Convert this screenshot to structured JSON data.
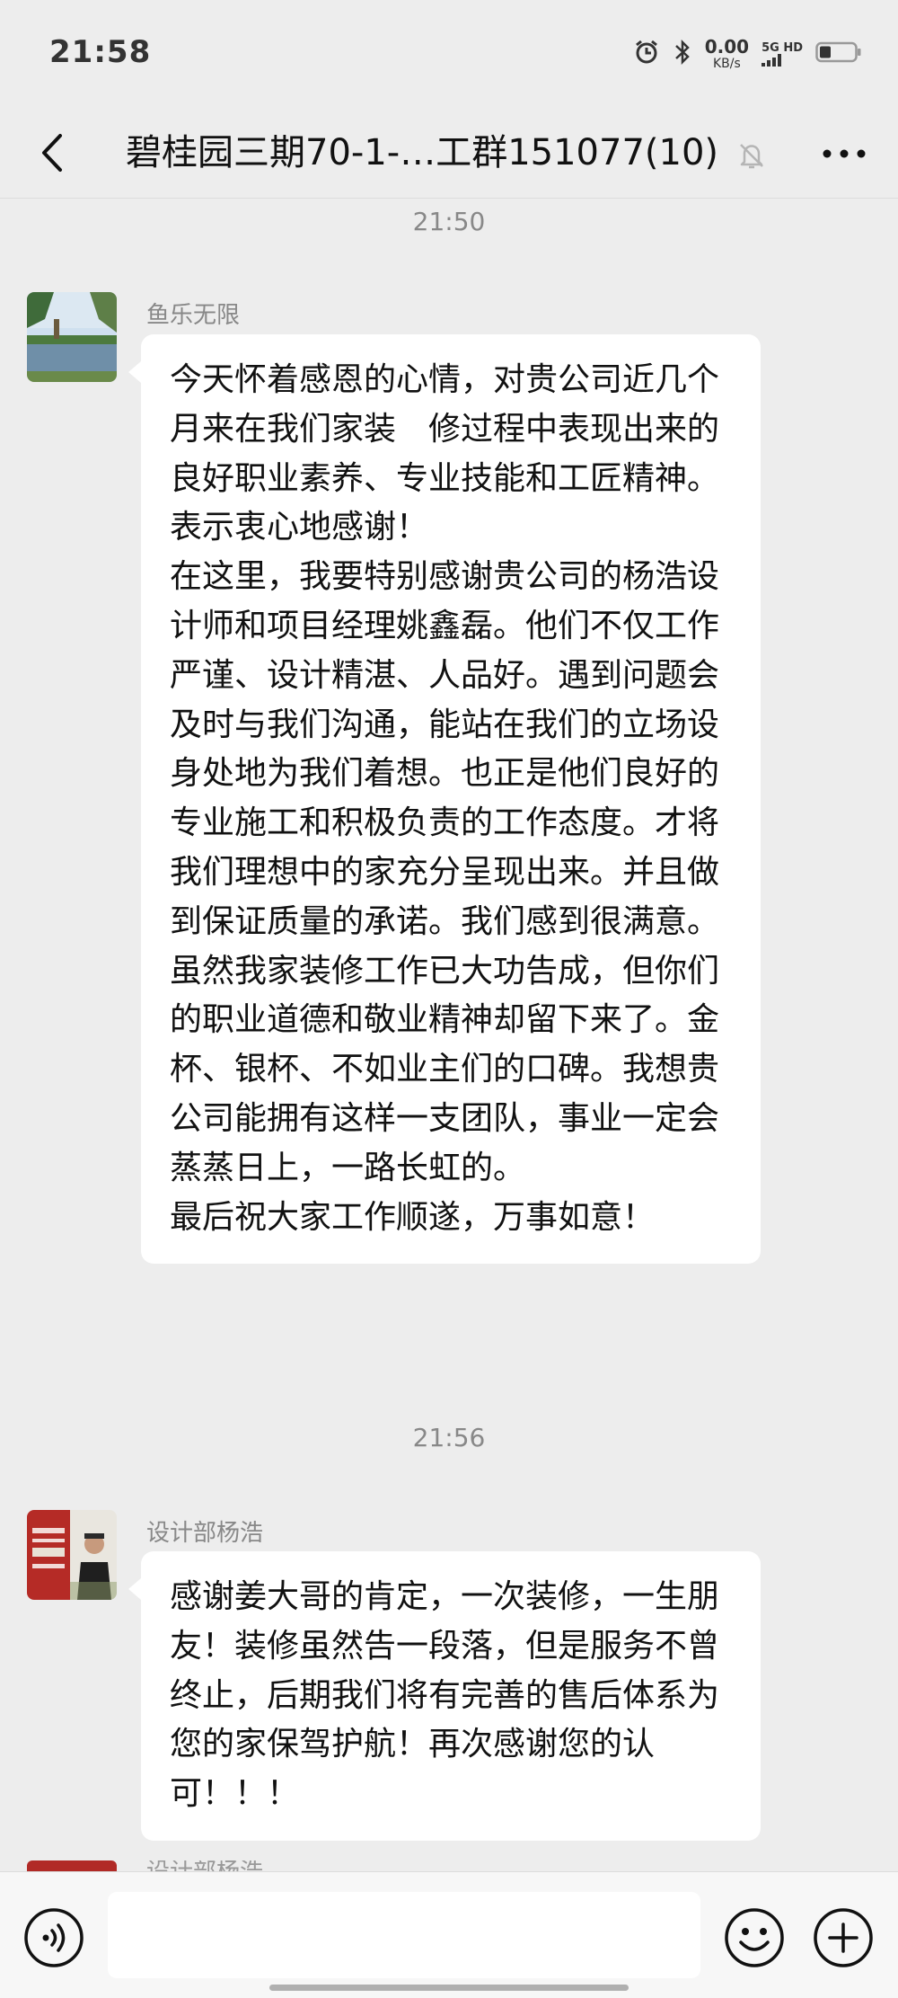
{
  "status_bar": {
    "time": "21:58",
    "speed_value": "0.00",
    "speed_unit": "KB/s",
    "network_label": "5G HD"
  },
  "header": {
    "title": "碧桂园三期70-1-…工群151077(10)"
  },
  "messages": [
    {
      "timestamp": "21:50",
      "sender": "鱼乐无限",
      "text": "今天怀着感恩的心情，对贵公司近几个月来在我们家装　修过程中表现出来的良好职业素养、专业技能和工匠精神。表示衷心地感谢！\n在这里，我要特别感谢贵公司的杨浩设计师和项目经理姚鑫磊。他们不仅工作严谨、设计精湛、人品好。遇到问题会及时与我们沟通，能站在我们的立场设身处地为我们着想。也正是他们良好的专业施工和积极负责的工作态度。才将我们理想中的家充分呈现出来。并且做到保证质量的承诺。我们感到很满意。虽然我家装修工作已大功告成，但你们的职业道德和敬业精神却留下来了。金杯、银杯、不如业主们的口碑。我想贵公司能拥有这样一支团队，事业一定会蒸蒸日上，一路长虹的。\n最后祝大家工作顺遂，万事如意！"
    },
    {
      "timestamp": "21:56",
      "sender": "设计部杨浩",
      "text": "感谢姜大哥的肯定，一次装修，一生朋友！装修虽然告一段落，但是服务不曾终止，后期我们将有完善的售后体系为您的家保驾护航！再次感谢您的认可！！！"
    },
    {
      "sender": "设计部杨浩"
    }
  ],
  "input": {
    "value": "",
    "placeholder": ""
  },
  "colors": {
    "background": "#ededed",
    "bubble": "#ffffff",
    "meta_text": "#888888"
  }
}
